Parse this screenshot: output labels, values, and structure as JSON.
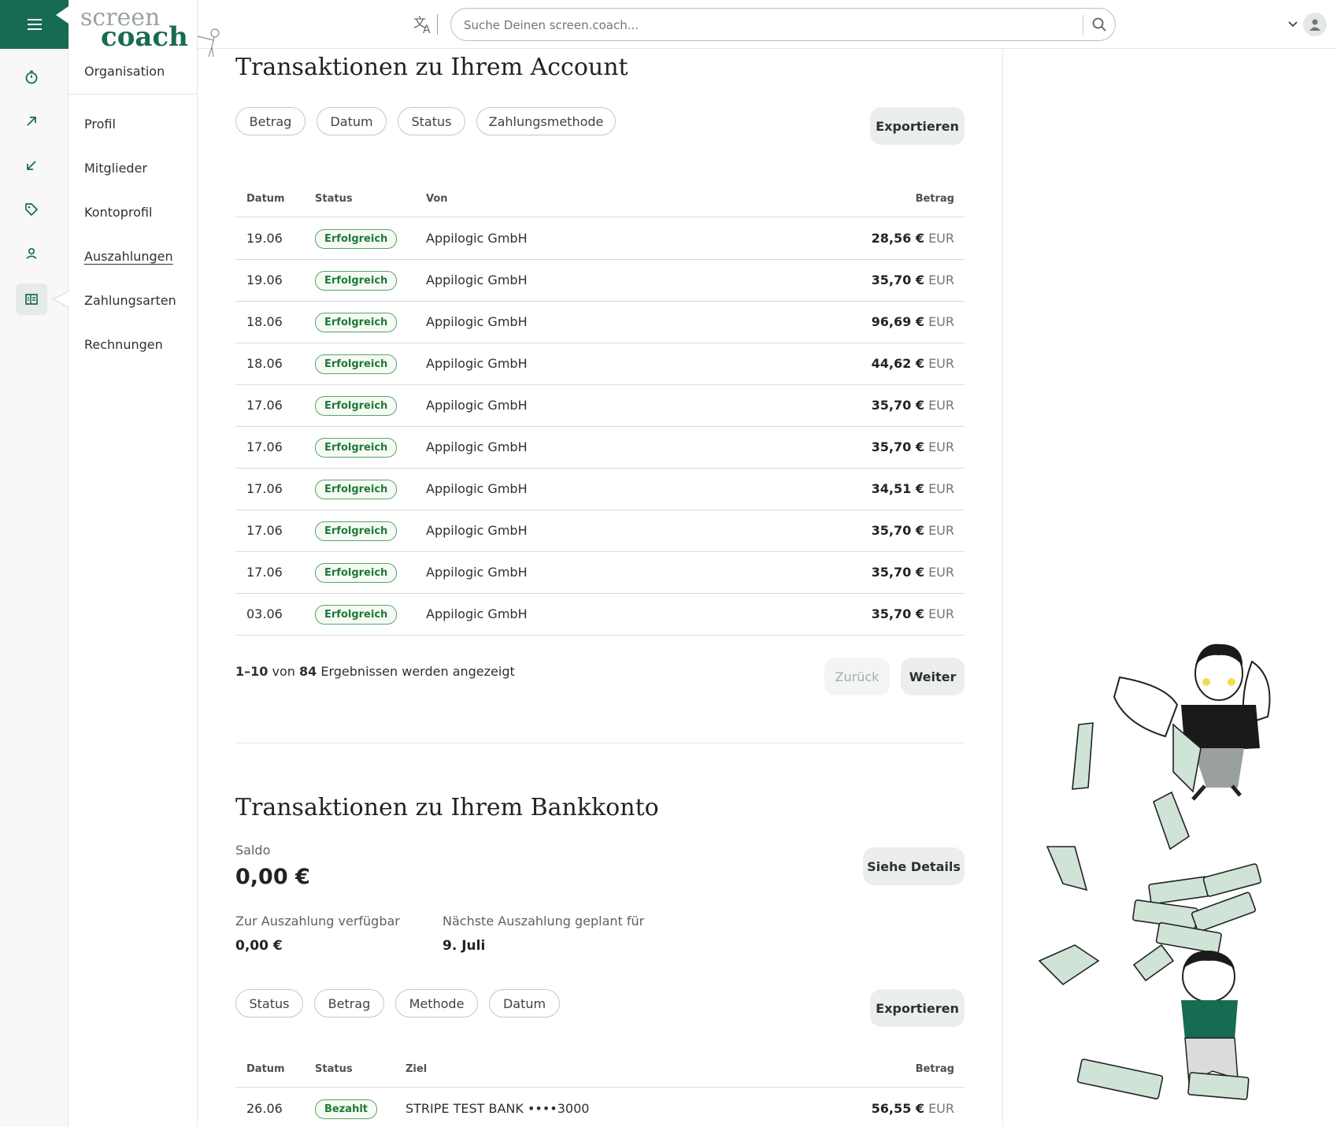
{
  "nav": {
    "header": "Organisation",
    "items": [
      {
        "label": "Profil",
        "active": false
      },
      {
        "label": "Mitglieder",
        "active": false
      },
      {
        "label": "Kontoprofil",
        "active": false
      },
      {
        "label": "Auszahlungen",
        "active": true
      },
      {
        "label": "Zahlungsarten",
        "active": false
      },
      {
        "label": "Rechnungen",
        "active": false
      }
    ]
  },
  "logo": {
    "line1": "screen",
    "line2": "coach"
  },
  "search": {
    "placeholder": "Suche Deinen screen.coach..."
  },
  "colors": {
    "brand": "#176b52",
    "success": "#1f7a34",
    "success_border": "#5aa469"
  },
  "account": {
    "title": "Transaktionen zu Ihrem Account",
    "filters": [
      "Betrag",
      "Datum",
      "Status",
      "Zahlungsmethode"
    ],
    "export_label": "Exportieren",
    "columns": {
      "date": "Datum",
      "status": "Status",
      "from": "Von",
      "amount": "Betrag"
    },
    "rows": [
      {
        "date": "19.06",
        "status": "Erfolgreich",
        "from": "Appilogic GmbH",
        "amount": "28,56 €",
        "currency": "EUR"
      },
      {
        "date": "19.06",
        "status": "Erfolgreich",
        "from": "Appilogic GmbH",
        "amount": "35,70 €",
        "currency": "EUR"
      },
      {
        "date": "18.06",
        "status": "Erfolgreich",
        "from": "Appilogic GmbH",
        "amount": "96,69 €",
        "currency": "EUR"
      },
      {
        "date": "18.06",
        "status": "Erfolgreich",
        "from": "Appilogic GmbH",
        "amount": "44,62 €",
        "currency": "EUR"
      },
      {
        "date": "17.06",
        "status": "Erfolgreich",
        "from": "Appilogic GmbH",
        "amount": "35,70 €",
        "currency": "EUR"
      },
      {
        "date": "17.06",
        "status": "Erfolgreich",
        "from": "Appilogic GmbH",
        "amount": "35,70 €",
        "currency": "EUR"
      },
      {
        "date": "17.06",
        "status": "Erfolgreich",
        "from": "Appilogic GmbH",
        "amount": "34,51 €",
        "currency": "EUR"
      },
      {
        "date": "17.06",
        "status": "Erfolgreich",
        "from": "Appilogic GmbH",
        "amount": "35,70 €",
        "currency": "EUR"
      },
      {
        "date": "17.06",
        "status": "Erfolgreich",
        "from": "Appilogic GmbH",
        "amount": "35,70 €",
        "currency": "EUR"
      },
      {
        "date": "03.06",
        "status": "Erfolgreich",
        "from": "Appilogic GmbH",
        "amount": "35,70 €",
        "currency": "EUR"
      }
    ],
    "pager": {
      "range": "1–10",
      "of_word": "von",
      "total": "84",
      "suffix": "Ergebnissen werden angezeigt",
      "back_label": "Zurück",
      "next_label": "Weiter"
    }
  },
  "bank": {
    "title": "Transaktionen zu Ihrem Bankkonto",
    "saldo_label": "Saldo",
    "saldo_value": "0,00 €",
    "details_label": "Siehe Details",
    "available_label": "Zur Auszahlung verfügbar",
    "available_value": "0,00 €",
    "next_payout_label": "Nächste Auszahlung geplant für",
    "next_payout_value": "9. Juli",
    "filters": [
      "Status",
      "Betrag",
      "Methode",
      "Datum"
    ],
    "export_label": "Exportieren",
    "columns": {
      "date": "Datum",
      "status": "Status",
      "target": "Ziel",
      "amount": "Betrag"
    },
    "rows": [
      {
        "date": "26.06",
        "status": "Bezahlt",
        "target": "STRIPE TEST BANK ••••3000",
        "amount": "56,55 €",
        "currency": "EUR"
      }
    ]
  }
}
